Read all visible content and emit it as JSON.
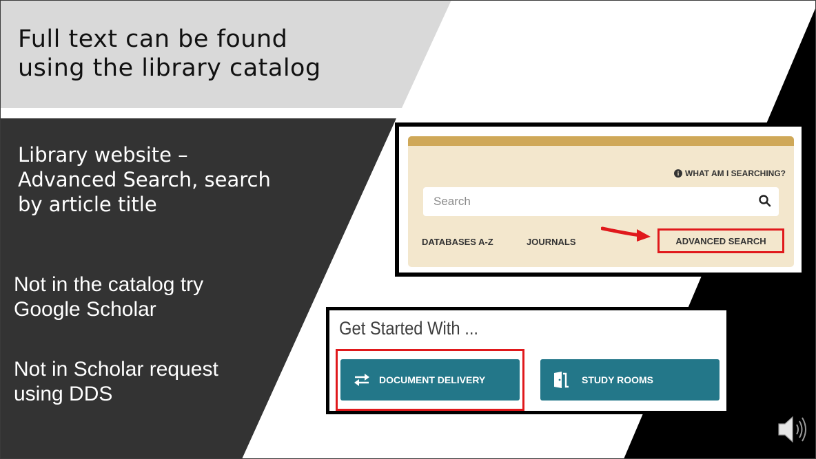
{
  "slide": {
    "title_lines": [
      "Full text can be found",
      "using the library catalog"
    ],
    "bullet1_lines": [
      "Library website –",
      "Advanced Search, search",
      "by article title"
    ],
    "bullet2_lines": [
      "Not in the catalog try",
      "Google Scholar"
    ],
    "bullet3_lines": [
      "Not in Scholar request",
      "using DDS"
    ]
  },
  "library_search": {
    "info_link": "WHAT AM I SEARCHING?",
    "search_placeholder": "Search",
    "links": {
      "databases": "DATABASES A-Z",
      "journals": "JOURNALS",
      "advanced_search": "ADVANCED SEARCH"
    }
  },
  "get_started": {
    "title": "Get Started With ...",
    "tiles": {
      "document_delivery": "DOCUMENT DELIVERY",
      "study_rooms": "STUDY ROOMS"
    }
  },
  "icons": {
    "info": "info-icon",
    "search": "search-icon",
    "pointer_arrow": "red-arrow-icon",
    "swap": "swap-arrows-icon",
    "door": "door-icon",
    "audio": "speaker-icon"
  },
  "colors": {
    "title_band": "#d9d9d9",
    "dark_band": "#333333",
    "black_band": "#000000",
    "panel_bg": "#f3e7cd",
    "panel_accent": "#cfa858",
    "tile": "#237789",
    "highlight": "#e0191c"
  }
}
